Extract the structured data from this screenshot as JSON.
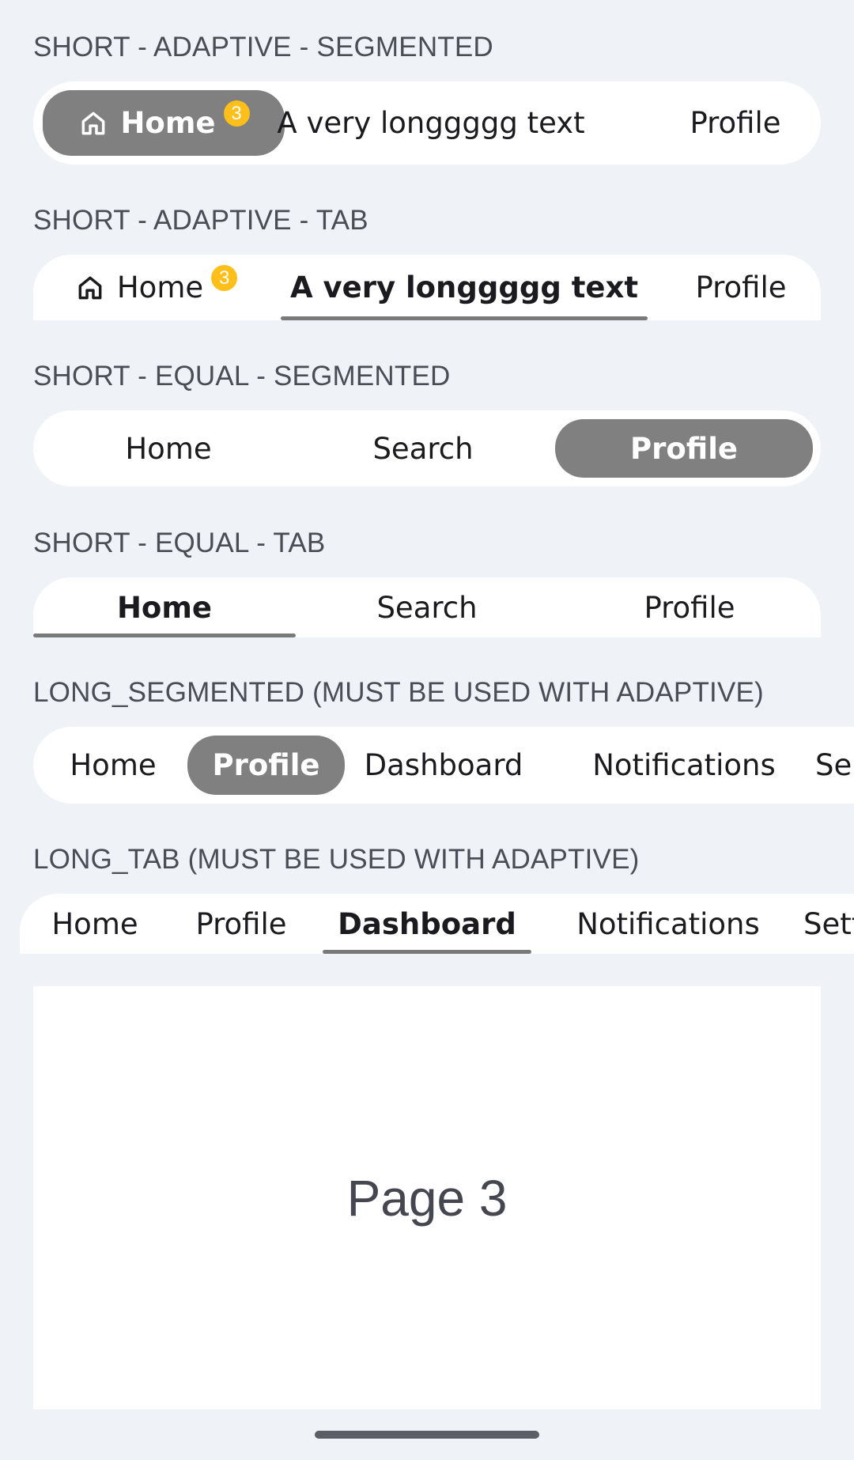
{
  "sections": {
    "s1_title": "SHORT - ADAPTIVE - SEGMENTED",
    "s2_title": "SHORT - ADAPTIVE - TAB",
    "s3_title": "SHORT - EQUAL - SEGMENTED",
    "s4_title": "SHORT - EQUAL - TAB",
    "s5_title": "LONG_SEGMENTED (MUST BE USED WITH ADAPTIVE)",
    "s6_title": "LONG_TAB (MUST BE USED WITH ADAPTIVE)"
  },
  "short_adaptive_segmented": {
    "items": [
      {
        "label": "Home",
        "icon": "home-icon",
        "badge": "3",
        "selected": true
      },
      {
        "label": "A very longgggg text",
        "selected": false
      },
      {
        "label": "Profile",
        "selected": false
      }
    ]
  },
  "short_adaptive_tab": {
    "items": [
      {
        "label": "Home",
        "icon": "home-icon",
        "badge": "3",
        "selected": false
      },
      {
        "label": "A very longgggg text",
        "selected": true
      },
      {
        "label": "Profile",
        "selected": false
      }
    ]
  },
  "short_equal_segmented": {
    "items": [
      {
        "label": "Home",
        "selected": false
      },
      {
        "label": "Search",
        "selected": false
      },
      {
        "label": "Profile",
        "selected": true
      }
    ]
  },
  "short_equal_tab": {
    "items": [
      {
        "label": "Home",
        "selected": true
      },
      {
        "label": "Search",
        "selected": false
      },
      {
        "label": "Profile",
        "selected": false
      }
    ]
  },
  "long_segmented": {
    "items": [
      {
        "label": "Home",
        "selected": false
      },
      {
        "label": "Profile",
        "selected": true
      },
      {
        "label": "Dashboard",
        "selected": false
      },
      {
        "label": "Notifications",
        "selected": false
      },
      {
        "label": "Se",
        "selected": false
      }
    ]
  },
  "long_tab": {
    "items": [
      {
        "label": "Home",
        "selected": false
      },
      {
        "label": "Profile",
        "selected": false
      },
      {
        "label": "Dashboard",
        "selected": true
      },
      {
        "label": "Notifications",
        "selected": false
      },
      {
        "label": "Sett",
        "selected": false
      }
    ]
  },
  "content": {
    "page_label": "Page 3"
  },
  "colors": {
    "background": "#eff2f6",
    "selected_segment": "#808080",
    "indicator": "#7a7a7a",
    "badge": "#ffbf1a"
  }
}
